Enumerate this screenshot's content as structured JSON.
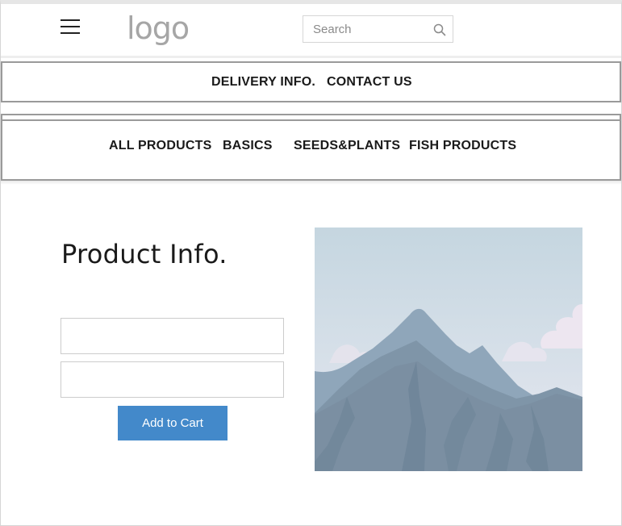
{
  "header": {
    "menu_icon": "hamburger-icon",
    "logo_text": "logo",
    "search": {
      "placeholder": "Search",
      "value": "",
      "icon": "search-icon"
    }
  },
  "nav_primary": [
    {
      "label": "DELIVERY INFO."
    },
    {
      "label": "CONTACT US"
    }
  ],
  "nav_categories": [
    {
      "label": "ALL PRODUCTS"
    },
    {
      "label": "BASICS"
    },
    {
      "label": "SEEDS&PLANTS"
    },
    {
      "label": "FISH PRODUCTS"
    }
  ],
  "product": {
    "title": "Product Info.",
    "field1_value": "",
    "field2_value": "",
    "add_to_cart_label": "Add to Cart",
    "image_icon": "mountain-image-placeholder"
  },
  "colors": {
    "button": "#4389ca",
    "logo": "#a6a6a6",
    "nav_border": "#9a9a9a"
  }
}
